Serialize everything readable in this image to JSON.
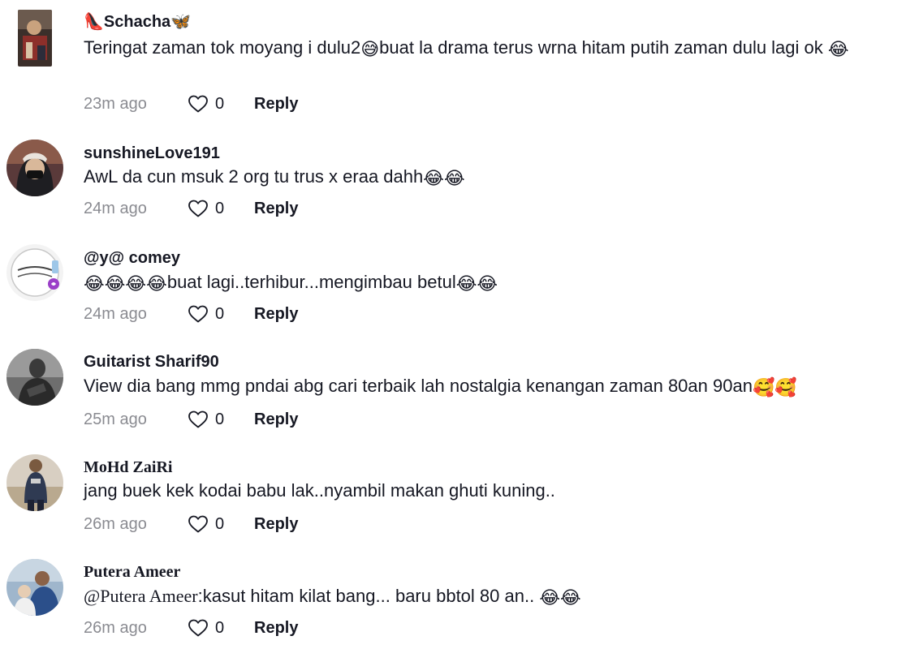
{
  "comments": [
    {
      "username_prefix": "👠",
      "username": "Schacha",
      "username_suffix": "🦋",
      "text_parts": [
        "Teringat zaman tok moyang i dulu2",
        "😅",
        "buat la drama terus wrna hitam putih zaman dulu lagi ok",
        "😂"
      ],
      "time": "23m ago",
      "likes": "0",
      "reply": "Reply"
    },
    {
      "username": "sunshineLove191",
      "text": "AwL da cun msuk 2 org tu trus x eraa dahh",
      "emojis": "😂😂",
      "time": "24m ago",
      "likes": "0",
      "reply": "Reply"
    },
    {
      "username": "@y@ comey",
      "emojis_before": "😂😂😂😂",
      "text": "buat lagi..terhibur...mengimbau betul",
      "emojis_after": "😂😂",
      "time": "24m ago",
      "likes": "0",
      "reply": "Reply"
    },
    {
      "username": "Guitarist Sharif90",
      "text": "View dia bang mmg pndai abg cari terbaik lah nostalgia kenangan zaman 80an 90an",
      "emojis": "🥰🥰",
      "time": "25m ago",
      "likes": "0",
      "reply": "Reply"
    },
    {
      "username": "MoHd ZaiRi",
      "text": "jang buek kek kodai babu lak..nyambil makan ghuti kuning..",
      "time": "26m ago",
      "likes": "0",
      "reply": "Reply"
    },
    {
      "username": "Putera Ameer",
      "mention": "@Putera Ameer",
      "text": ":kasut hitam kilat bang... baru bbtol 80 an.. ",
      "emojis": "😂😂",
      "time": "26m ago",
      "likes": "0",
      "reply": "Reply"
    }
  ],
  "icons": {
    "like": "heart-outline-icon"
  },
  "colors": {
    "text": "#161823",
    "muted": "#8a8b91"
  }
}
